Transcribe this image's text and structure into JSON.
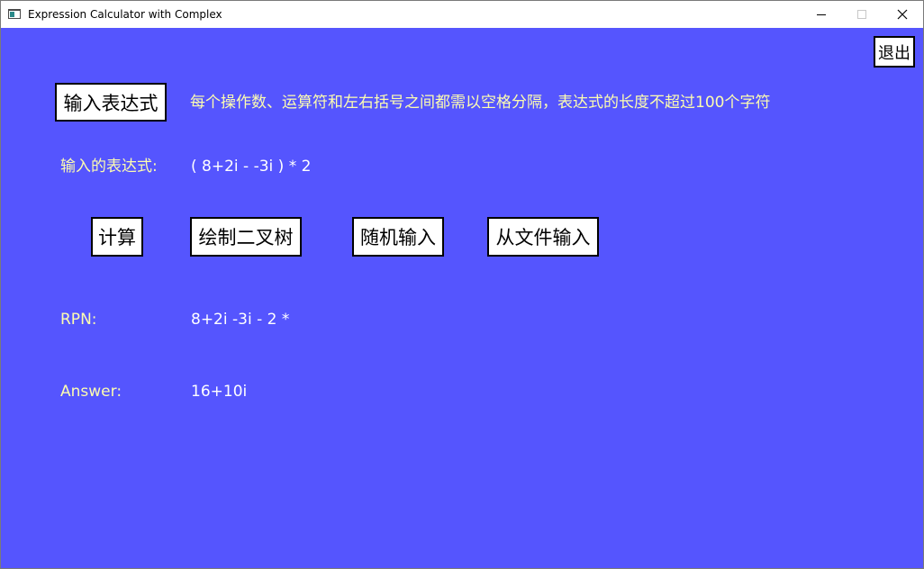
{
  "window": {
    "title": "Expression Calculator with Complex",
    "icons": {
      "app": "app-window-icon",
      "minimize": "minimize-icon",
      "maximize": "maximize-icon",
      "close": "close-icon"
    }
  },
  "colors": {
    "background": "#5555fe",
    "label_text": "#fdfdb0",
    "value_text": "#ffffff",
    "button_bg": "#ffffff",
    "button_border": "#000000"
  },
  "buttons": {
    "exit": "退出",
    "input_expression": "输入表达式",
    "calculate": "计算",
    "draw_tree": "绘制二叉树",
    "random_input": "随机输入",
    "file_input": "从文件输入"
  },
  "hint": "每个操作数、运算符和左右括号之间都需以空格分隔，表达式的长度不超过100个字符",
  "expression": {
    "label": "输入的表达式:",
    "value": "( 8+2i - -3i ) * 2"
  },
  "rpn": {
    "label": "RPN:",
    "value": "8+2i -3i - 2 *"
  },
  "answer": {
    "label": "Answer:",
    "value": "16+10i"
  }
}
